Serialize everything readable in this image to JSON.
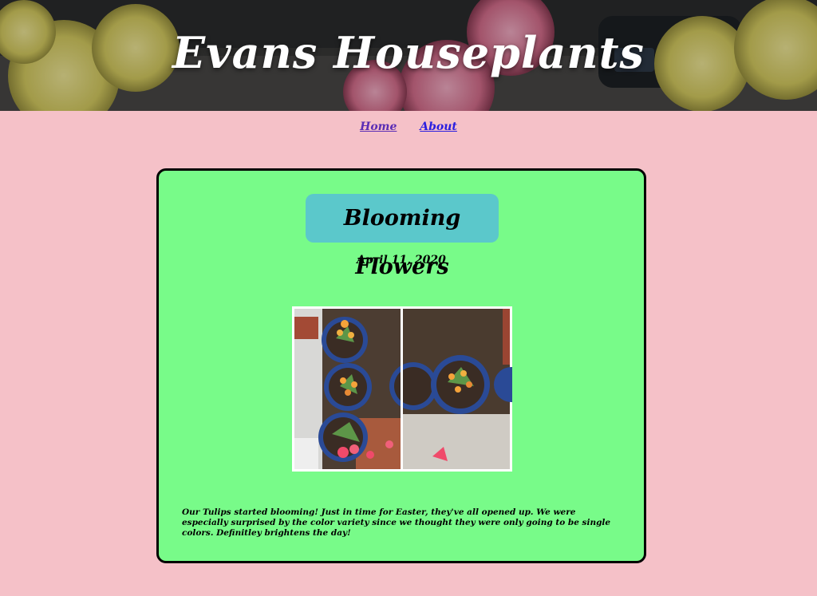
{
  "header": {
    "site_title": "Evans Houseplants"
  },
  "nav": {
    "items": [
      {
        "label": "Home"
      },
      {
        "label": "About"
      }
    ]
  },
  "post": {
    "title": "Blooming Flowers",
    "date": "April 11, 2020",
    "body": "Our Tulips started blooming! Just in time for Easter, they've all opened up. We were especially surprised by the color variety since we thought they were only going to be single colors. Definitley brightens the day!"
  },
  "colors": {
    "page_background": "#f5c1c8",
    "card_background": "#78fb89",
    "title_badge": "#5bc8cb",
    "nav_link": "#5a2db5"
  }
}
